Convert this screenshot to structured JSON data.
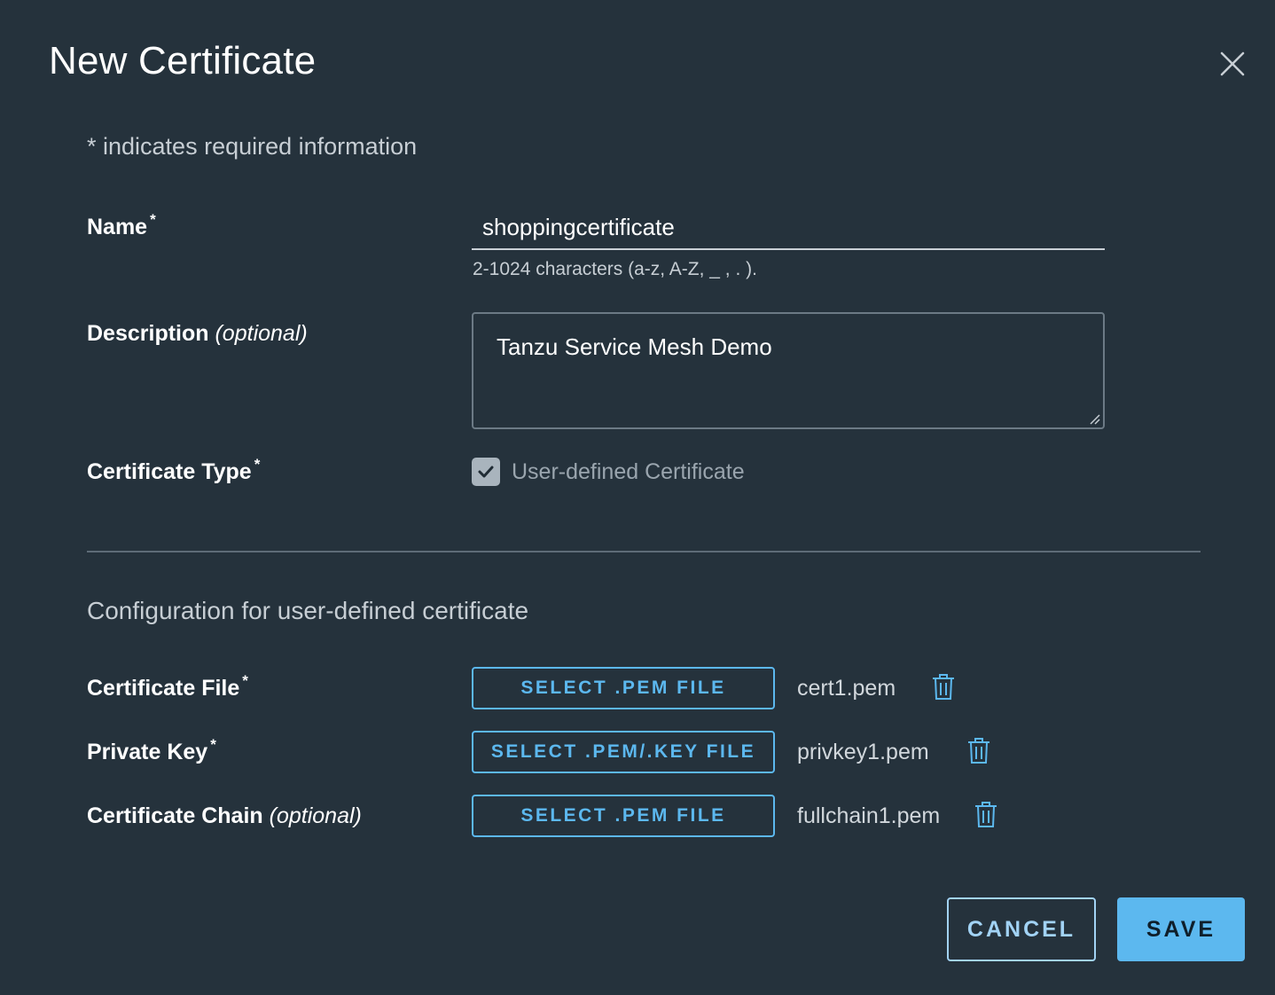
{
  "dialog": {
    "title": "New Certificate",
    "required_note": "* indicates required information"
  },
  "form": {
    "name": {
      "label": "Name",
      "required_mark": "*",
      "value": "shoppingcertificate",
      "helper": "2-1024 characters (a-z, A-Z, _ , . )."
    },
    "description": {
      "label": "Description",
      "optional_text": "(optional)",
      "value": "Tanzu Service Mesh Demo"
    },
    "certificate_type": {
      "label": "Certificate Type",
      "required_mark": "*",
      "option_label": "User-defined Certificate",
      "checked": true
    }
  },
  "config": {
    "section_title": "Configuration for user-defined certificate",
    "rows": [
      {
        "label": "Certificate File",
        "required_mark": "*",
        "optional_text": "",
        "button": "SELECT .PEM FILE",
        "file": "cert1.pem"
      },
      {
        "label": "Private Key",
        "required_mark": "*",
        "optional_text": "",
        "button": "SELECT .PEM/.KEY FILE",
        "file": "privkey1.pem"
      },
      {
        "label": "Certificate Chain",
        "required_mark": "",
        "optional_text": "(optional)",
        "button": "SELECT .PEM FILE",
        "file": "fullchain1.pem"
      }
    ]
  },
  "actions": {
    "cancel": "CANCEL",
    "save": "SAVE"
  },
  "icons": {
    "close": "close-icon",
    "trash": "trash-icon",
    "check": "check-icon"
  },
  "colors": {
    "background": "#25323c",
    "accent": "#5cb8ef",
    "cancel_border": "#a2d3f5"
  }
}
